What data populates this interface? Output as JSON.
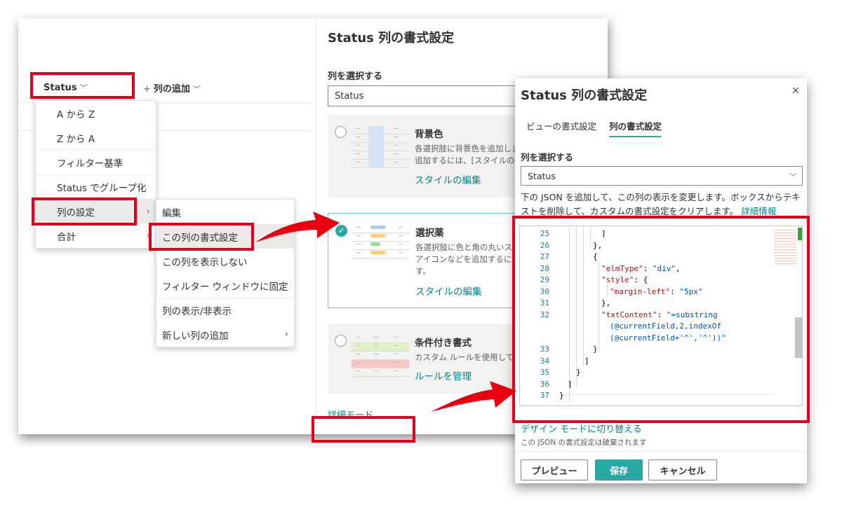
{
  "list": {
    "status_header": "Status",
    "add_column": "列の追加",
    "add_plus": "+",
    "chevron": "﹀"
  },
  "sort_menu": {
    "items": [
      {
        "label": "A から Z"
      },
      {
        "label": "Z から A"
      },
      {
        "label": "フィルター基準"
      },
      {
        "label": "Status でグループ化"
      },
      {
        "label": "列の設定",
        "submenu": "›"
      },
      {
        "label": "合計",
        "submenu": "›"
      }
    ]
  },
  "column_settings_menu": {
    "items": [
      {
        "label": "編集"
      },
      {
        "label": "この列の書式設定"
      },
      {
        "label": "この列を表示しない"
      },
      {
        "label": "フィルター ウィンドウに固定"
      },
      {
        "label": "列の表示/非表示"
      },
      {
        "label": "新しい列の追加",
        "submenu": "›"
      }
    ]
  },
  "panel1": {
    "title": "Status 列の書式設定",
    "select_label": "列を選択する",
    "select_value": "Status",
    "cards": [
      {
        "title": "背景色",
        "desc1": "各選択肢に背景色を追加しま",
        "desc2": "追加するには、[スタイルの編",
        "link": "スタイルの編集"
      },
      {
        "title": "選択薬",
        "desc1": "各選択肢に色と角の丸いスタ",
        "desc2": "アイコンなどを追加するには",
        "desc3": "す。",
        "link": "スタイルの編集"
      },
      {
        "title": "条件付き書式",
        "desc1": "カスタム ルールを使用して",
        "link": "ルールを管理"
      }
    ],
    "advanced_link": "詳細モード"
  },
  "dialog": {
    "title": "Status 列の書式設定",
    "close_glyph": "✕",
    "tabs": [
      "ビューの書式設定",
      "列の書式設定"
    ],
    "select_label": "列を選択する",
    "select_value": "Status",
    "help_text_1": "下の JSON を追加して、この列の表示を変更します。ボックスからテキ",
    "help_text_2": "ストを削除して、カスタムの書式設定をクリアします。",
    "help_link": "詳細情報",
    "design_mode_link": "デザイン モードに切り替える",
    "discard_note": "この JSON の書式設定は破棄されます",
    "buttons": {
      "preview": "プレビュー",
      "save": "保存",
      "cancel": "キャンセル"
    }
  },
  "code": {
    "lines": [
      {
        "n": "25",
        "text": "]"
      },
      {
        "n": "26",
        "text": "},"
      },
      {
        "n": "27",
        "text": "{"
      },
      {
        "n": "28",
        "k": "\"elmType\"",
        "sep": ": ",
        "v": "\"div\"",
        "end": ","
      },
      {
        "n": "29",
        "k": "\"style\"",
        "sep": ": {",
        "v": "",
        "end": ""
      },
      {
        "n": "30",
        "k": "\"margin-left\"",
        "sep": ": ",
        "v": "\"5px\"",
        "end": ""
      },
      {
        "n": "31",
        "text": "},"
      },
      {
        "n": "32",
        "k": "\"txtContent\"",
        "sep": ": ",
        "v": "\"=substring",
        "end": ""
      },
      {
        "n": "",
        "v": "(@currentField,2,indexOf"
      },
      {
        "n": "",
        "v": "(@currentField+'^','^'))\""
      },
      {
        "n": "33",
        "text": "}"
      },
      {
        "n": "34",
        "text": "]"
      },
      {
        "n": "35",
        "text": "}"
      },
      {
        "n": "36",
        "text": "]"
      },
      {
        "n": "37",
        "text": "}"
      }
    ]
  },
  "colors": {
    "accent": "#2aa8a4",
    "highlight": "#e2001a",
    "arrow": "#e8000f"
  }
}
